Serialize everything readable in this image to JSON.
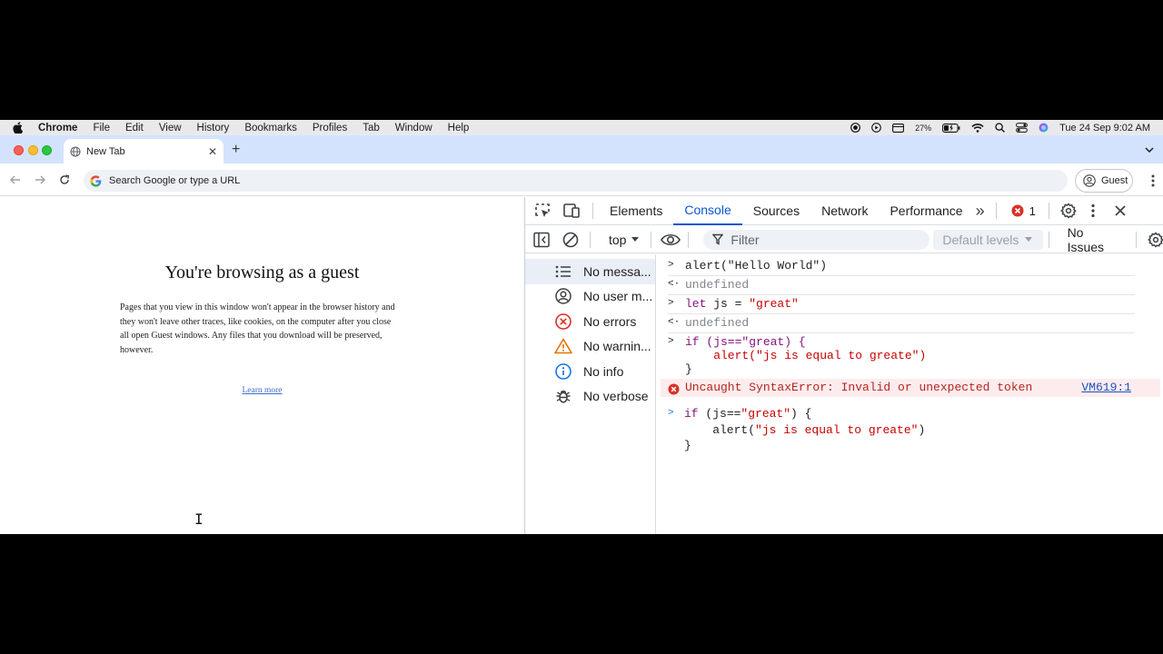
{
  "menubar": {
    "app": "Chrome",
    "items": [
      "File",
      "Edit",
      "View",
      "History",
      "Bookmarks",
      "Profiles",
      "Tab",
      "Window",
      "Help"
    ],
    "battery": "27%",
    "datetime": "Tue 24 Sep  9:02 AM"
  },
  "browser": {
    "tab_title": "New Tab",
    "new_tab_symbol": "+",
    "close_symbol": "✕",
    "omnibox_placeholder": "Search Google or type a URL",
    "profile_label": "Guest"
  },
  "page": {
    "heading": "You're browsing as a guest",
    "body": "Pages that you view in this window won't appear in the browser history and they won't leave other traces, like cookies, on the computer after you close all open Guest windows. Any files that you download will be preserved, however.",
    "link": "Learn more"
  },
  "devtools": {
    "tabs": [
      "Elements",
      "Console",
      "Sources",
      "Network",
      "Performance"
    ],
    "active_tab": "Console",
    "more_tabs_symbol": "»",
    "error_count": "1",
    "context": "top",
    "filter_placeholder": "Filter",
    "levels": "Default levels",
    "issues": "No Issues",
    "sidebar": [
      {
        "label": "No messa...",
        "icon": "list-icon"
      },
      {
        "label": "No user m...",
        "icon": "user-icon"
      },
      {
        "label": "No errors",
        "icon": "error-icon"
      },
      {
        "label": "No warnin...",
        "icon": "warning-icon"
      },
      {
        "label": "No info",
        "icon": "info-icon"
      },
      {
        "label": "No verbose",
        "icon": "bug-icon"
      }
    ],
    "console": {
      "input_marker": ">",
      "result_marker": "<·",
      "entry1": "alert(\"Hello World\")",
      "result1": "undefined",
      "entry2_kw": "let",
      "entry2_rest": " js = ",
      "entry2_str": "\"great\"",
      "result2": "undefined",
      "entry3_line1": "if (js==\"great) {",
      "entry3_line2": "    alert(\"js is equal to greate\")",
      "entry3_line3": "}",
      "error_text": "Uncaught SyntaxError: Invalid or unexpected token",
      "error_source": "VM619:1",
      "prompt_marker": ">",
      "prompt_kw": "if",
      "prompt_line1_rest": " (js==",
      "prompt_line1_str": "\"great\"",
      "prompt_line1_end": ") {",
      "prompt_line2_fn": "    alert(",
      "prompt_line2_str": "\"js is equal to greate\"",
      "prompt_line2_end": ")",
      "prompt_line3": "}"
    }
  },
  "colors": {
    "accent": "#0b57d0",
    "error": "#d93025",
    "tabstrip": "#d3e3fd"
  }
}
